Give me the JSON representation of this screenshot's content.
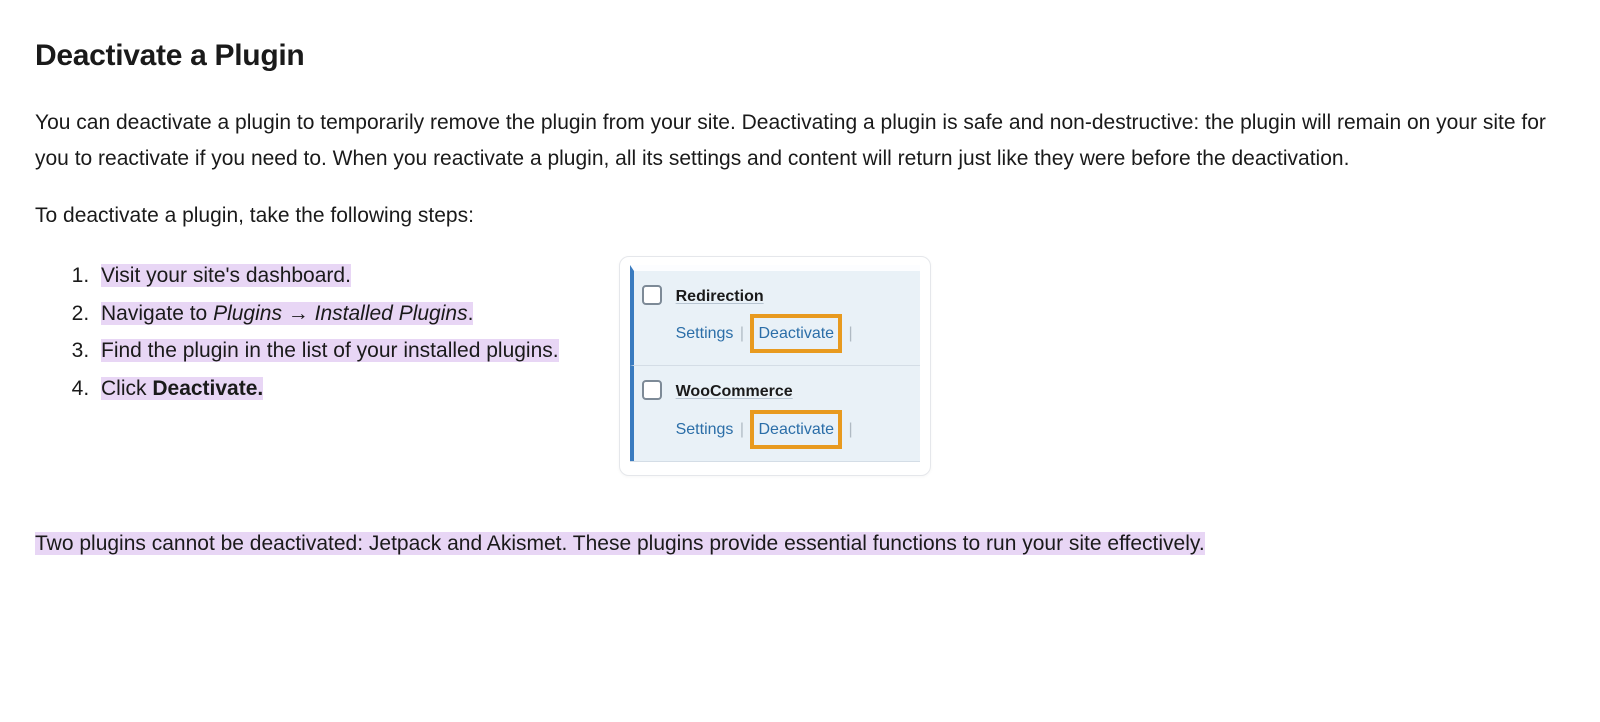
{
  "heading": "Deactivate a Plugin",
  "intro": "You can deactivate a plugin to temporarily remove the plugin from your site. Deactivating a plugin is safe and non-destructive: the plugin will remain on your site for you to reactivate if you need to. When you reactivate a plugin, all its settings and content will return just like they were before the deactivation.",
  "lead": "To deactivate a plugin, take the following steps:",
  "steps": {
    "s1": "Visit your site's dashboard.",
    "s2_pre": "Navigate to ",
    "s2_plugins": "Plugins",
    "s2_arrow": " → ",
    "s2_installed": "Installed Plugins",
    "s2_post": ".",
    "s3": "Find the plugin in the list of your installed plugins.",
    "s4_pre": "Click ",
    "s4_bold": "Deactivate."
  },
  "shot": {
    "rows": [
      {
        "name": "Redirection",
        "settings": "Settings",
        "deactivate": "Deactivate"
      },
      {
        "name": "WooCommerce",
        "settings": "Settings",
        "deactivate": "Deactivate"
      }
    ],
    "sep": "|"
  },
  "note": "Two plugins cannot be deactivated: Jetpack and Akismet. These plugins provide essential functions to run your site effectively."
}
